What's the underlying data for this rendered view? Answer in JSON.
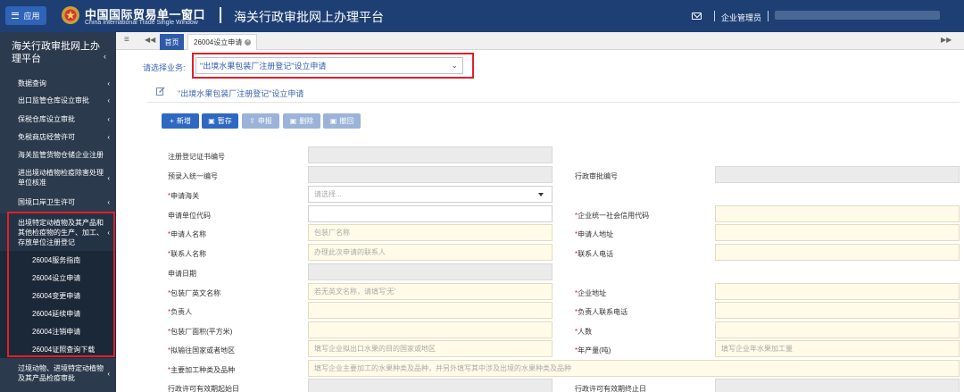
{
  "colors": {
    "header_bg": "#1d3f74",
    "sidebar_bg": "#2b3a4d",
    "accent": "#2f68c2",
    "highlight_border": "#e0202a"
  },
  "topbar": {
    "app_label": "应用",
    "brand_cn": "中国国际贸易单一窗口",
    "brand_en": "China International Trade Single Window",
    "platform_title": "海关行政审批网上办理平台",
    "user_role": "企业管理员"
  },
  "sidebar": {
    "title": "海关行政审批网上办理平台",
    "items": [
      {
        "label": "数据查询"
      },
      {
        "label": "出口监管仓库设立审批"
      },
      {
        "label": "保税仓库设立审批"
      },
      {
        "label": "免税商店经营许可"
      },
      {
        "label": "海关监管货物仓储企业注册"
      },
      {
        "label": "进出境动植物检疫除害处理单位核准"
      },
      {
        "label": "国境口岸卫生许可"
      },
      {
        "label": "出境特定动植物及其产品和其他检疫物的生产、加工、存放单位注册登记"
      },
      {
        "label": "26004服务指南"
      },
      {
        "label": "26004设立申请"
      },
      {
        "label": "26004变更申请"
      },
      {
        "label": "26004延续申请"
      },
      {
        "label": "26004注销申请"
      },
      {
        "label": "26004证照查询下载"
      },
      {
        "label": "过境动物、进境特定动植物及其产品检疫审批"
      }
    ]
  },
  "tabs": {
    "home": "首页",
    "active": "26004设立申请"
  },
  "main": {
    "select_label": "请选择业务:",
    "select_value": "\"出境水果包装厂注册登记\"设立申请",
    "form_title": "\"出境水果包装厂注册登记\"设立申请",
    "buttons": {
      "new": "新增",
      "save": "暂存",
      "submit": "申报",
      "delete": "删除",
      "withdraw": "撤回"
    }
  },
  "form": {
    "reg_cert_no": {
      "label": "注册登记证书编号"
    },
    "pre_entry_no": {
      "label": "预录入统一编号"
    },
    "admin_approval_no": {
      "label": "行政审批编号"
    },
    "customs": {
      "label": "申请海关",
      "placeholder": "请选择..."
    },
    "applicant_code": {
      "label": "申请单位代码"
    },
    "credit_code": {
      "label": "企业统一社会信用代码"
    },
    "applicant_name": {
      "label": "申请人名称",
      "placeholder": "包装厂名称"
    },
    "applicant_address": {
      "label": "申请人地址"
    },
    "contact_name": {
      "label": "联系人名称",
      "placeholder": "办理此次申请的联系人"
    },
    "contact_phone": {
      "label": "联系人电话"
    },
    "apply_date": {
      "label": "申请日期"
    },
    "english_name": {
      "label": "包装厂英文名称",
      "placeholder": "若无英文名称，请填写'无'"
    },
    "company_address": {
      "label": "企业地址"
    },
    "person_in_charge": {
      "label": "负责人"
    },
    "person_phone": {
      "label": "负责人联系电话"
    },
    "plant_area": {
      "label": "包装厂面积(平方米)"
    },
    "headcount": {
      "label": "人数"
    },
    "export_country": {
      "label": "拟输往国家或者地区",
      "placeholder": "填写企业拟出口水果的目的国家或地区"
    },
    "annual_output": {
      "label": "年产量(吨)",
      "placeholder": "填写企业年水果加工量"
    },
    "processing_types": {
      "label": "主要加工种类及品种",
      "placeholder": "填写企业主要加工的水果种类及品种，并另外填写其中涉及出境的水果种类及品种"
    },
    "permit_start": {
      "label": "行政许可有效期起始日"
    },
    "permit_end": {
      "label": "行政许可有效期终止日"
    }
  }
}
